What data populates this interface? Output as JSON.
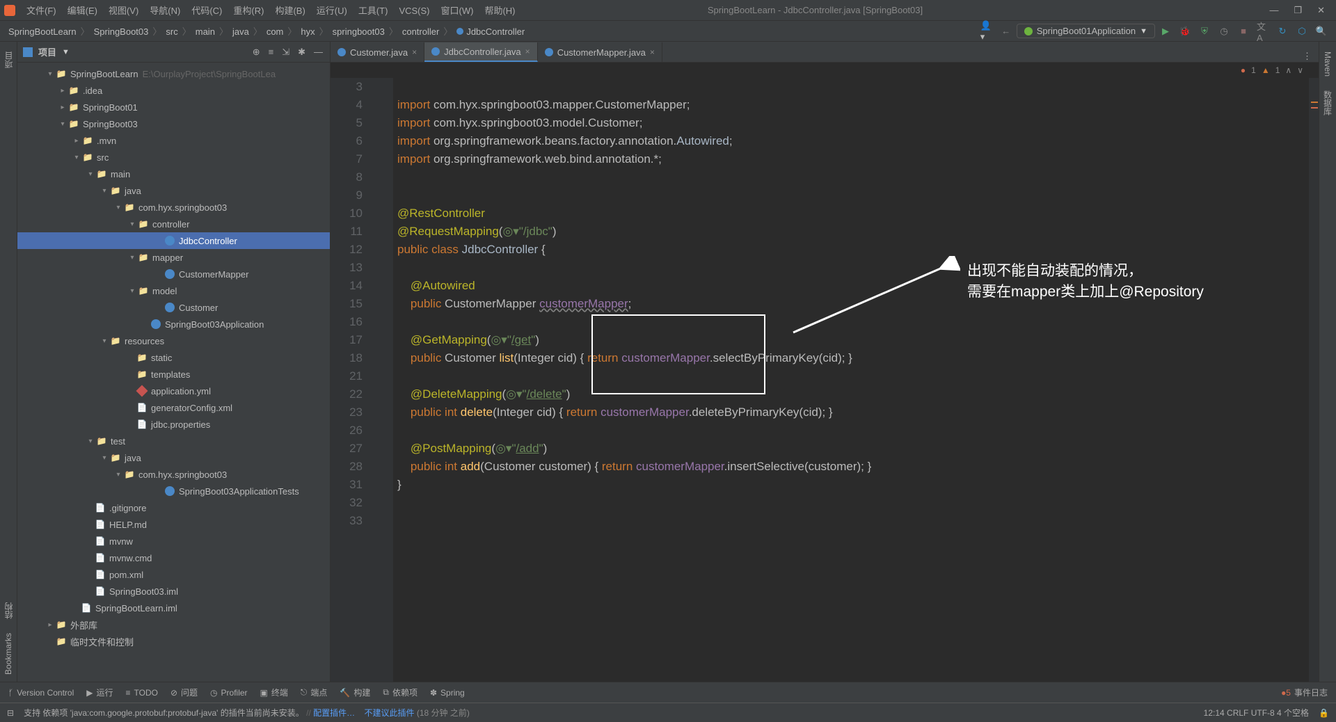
{
  "menu": [
    "文件(F)",
    "编辑(E)",
    "视图(V)",
    "导航(N)",
    "代码(C)",
    "重构(R)",
    "构建(B)",
    "运行(U)",
    "工具(T)",
    "VCS(S)",
    "窗口(W)",
    "帮助(H)"
  ],
  "window_title": "SpringBootLearn - JdbcController.java [SpringBoot03]",
  "breadcrumbs": [
    "SpringBootLearn",
    "SpringBoot03",
    "src",
    "main",
    "java",
    "com",
    "hyx",
    "springboot03",
    "controller",
    "JdbcController"
  ],
  "run_config": "SpringBoot01Application",
  "sidebar": {
    "title": "项目",
    "path_hint": "E:\\OurplayProject\\SpringBootLea"
  },
  "tree": [
    {
      "ind": 40,
      "arrow": "▾",
      "ico": "folder",
      "label": "SpringBootLearn",
      "hint": "E:\\OurplayProject\\SpringBootLea"
    },
    {
      "ind": 58,
      "arrow": "▸",
      "ico": "folder",
      "label": ".idea"
    },
    {
      "ind": 58,
      "arrow": "▸",
      "ico": "folder",
      "label": "SpringBoot01"
    },
    {
      "ind": 58,
      "arrow": "▾",
      "ico": "folder",
      "label": "SpringBoot03"
    },
    {
      "ind": 78,
      "arrow": "▸",
      "ico": "folder",
      "label": ".mvn"
    },
    {
      "ind": 78,
      "arrow": "▾",
      "ico": "folder",
      "label": "src"
    },
    {
      "ind": 98,
      "arrow": "▾",
      "ico": "folder",
      "label": "main"
    },
    {
      "ind": 118,
      "arrow": "▾",
      "ico": "folder",
      "label": "java"
    },
    {
      "ind": 138,
      "arrow": "▾",
      "ico": "folder",
      "label": "com.hyx.springboot03"
    },
    {
      "ind": 158,
      "arrow": "▾",
      "ico": "folder",
      "label": "controller"
    },
    {
      "ind": 196,
      "arrow": "",
      "ico": "class",
      "label": "JdbcController",
      "selected": true
    },
    {
      "ind": 158,
      "arrow": "▾",
      "ico": "folder",
      "label": "mapper"
    },
    {
      "ind": 196,
      "arrow": "",
      "ico": "class",
      "label": "CustomerMapper"
    },
    {
      "ind": 158,
      "arrow": "▾",
      "ico": "folder",
      "label": "model"
    },
    {
      "ind": 196,
      "arrow": "",
      "ico": "class",
      "label": "Customer"
    },
    {
      "ind": 176,
      "arrow": "",
      "ico": "class",
      "label": "SpringBoot03Application"
    },
    {
      "ind": 118,
      "arrow": "▾",
      "ico": "folder",
      "label": "resources"
    },
    {
      "ind": 156,
      "arrow": "",
      "ico": "folder",
      "label": "static"
    },
    {
      "ind": 156,
      "arrow": "",
      "ico": "folder",
      "label": "templates"
    },
    {
      "ind": 156,
      "arrow": "",
      "ico": "yml",
      "label": "application.yml"
    },
    {
      "ind": 156,
      "arrow": "",
      "ico": "file",
      "label": "generatorConfig.xml"
    },
    {
      "ind": 156,
      "arrow": "",
      "ico": "file",
      "label": "jdbc.properties"
    },
    {
      "ind": 98,
      "arrow": "▾",
      "ico": "folder",
      "label": "test"
    },
    {
      "ind": 118,
      "arrow": "▾",
      "ico": "folder",
      "label": "java"
    },
    {
      "ind": 138,
      "arrow": "▾",
      "ico": "folder",
      "label": "com.hyx.springboot03"
    },
    {
      "ind": 196,
      "arrow": "",
      "ico": "class",
      "label": "SpringBoot03ApplicationTests"
    },
    {
      "ind": 96,
      "arrow": "",
      "ico": "file",
      "label": ".gitignore"
    },
    {
      "ind": 96,
      "arrow": "",
      "ico": "file",
      "label": "HELP.md"
    },
    {
      "ind": 96,
      "arrow": "",
      "ico": "file",
      "label": "mvnw"
    },
    {
      "ind": 96,
      "arrow": "",
      "ico": "file",
      "label": "mvnw.cmd"
    },
    {
      "ind": 96,
      "arrow": "",
      "ico": "file",
      "label": "pom.xml"
    },
    {
      "ind": 96,
      "arrow": "",
      "ico": "file",
      "label": "SpringBoot03.iml"
    },
    {
      "ind": 76,
      "arrow": "",
      "ico": "file",
      "label": "SpringBootLearn.iml"
    },
    {
      "ind": 40,
      "arrow": "▸",
      "ico": "folder",
      "label": "外部库"
    },
    {
      "ind": 40,
      "arrow": "",
      "ico": "folder",
      "label": "临时文件和控制"
    }
  ],
  "tabs": [
    {
      "label": "Customer.java",
      "active": false
    },
    {
      "label": "JdbcController.java",
      "active": true
    },
    {
      "label": "CustomerMapper.java",
      "active": false
    }
  ],
  "editor_status": {
    "errors": "1",
    "warnings": "1"
  },
  "code_lines": [
    3,
    4,
    5,
    6,
    7,
    8,
    9,
    10,
    11,
    12,
    13,
    14,
    15,
    16,
    17,
    18,
    21,
    22,
    23,
    26,
    27,
    28,
    31,
    32,
    33
  ],
  "annotation": {
    "line1": "出现不能自动装配的情况，",
    "line2": "需要在mapper类上加上@Repository"
  },
  "left_tabs": [
    "项目",
    "结构",
    "Bookmarks"
  ],
  "right_tabs": [
    "Maven",
    "数据库"
  ],
  "bottom_items": [
    "Version Control",
    "运行",
    "TODO",
    "问题",
    "Profiler",
    "终端",
    "端点",
    "构建",
    "依赖项",
    "Spring"
  ],
  "events_label": "事件日志",
  "status": {
    "msg": "支持 依赖项 'java:com.google.protobuf:protobuf-java' 的插件当前尚未安装。",
    "links": [
      "配置插件…",
      "不建议此插件"
    ],
    "time": "(18 分钟 之前)",
    "right": "12:14   CRLF   UTF-8   4 个空格"
  }
}
